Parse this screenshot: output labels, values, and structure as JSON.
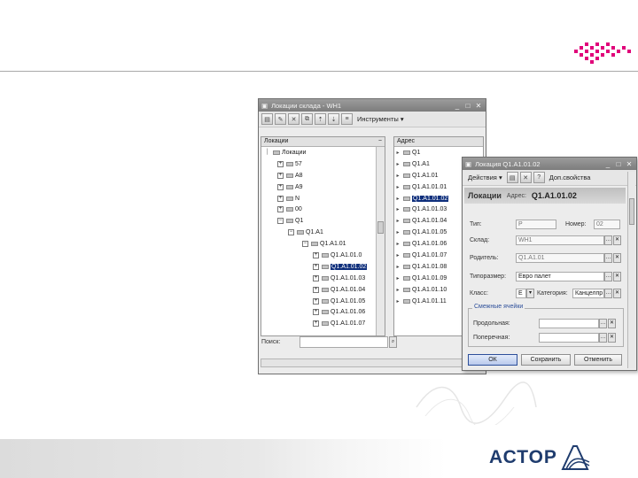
{
  "brand": {
    "logo_text": "АСТОР"
  },
  "main_window": {
    "title": "Локации склада - WH1",
    "toolbar": {
      "tools_menu": "Инструменты ▾"
    },
    "tree_header": "Локации",
    "tree_items": [
      {
        "label": "Локации"
      },
      {
        "label": "57"
      },
      {
        "label": "A8"
      },
      {
        "label": "A9"
      },
      {
        "label": "N"
      },
      {
        "label": "00"
      },
      {
        "label": "Q1"
      },
      {
        "label": "Q1.A1"
      },
      {
        "label": "Q1.A1.01"
      },
      {
        "label": "Q1.A1.01.0"
      },
      {
        "label": "Q1.A1.01.02"
      },
      {
        "label": "Q1.A1.01.03"
      },
      {
        "label": "Q1.A1.01.04"
      },
      {
        "label": "Q1.A1.01.05"
      },
      {
        "label": "Q1.A1.01.06"
      },
      {
        "label": "Q1.A1.01.07"
      }
    ],
    "address_header": "Адрес",
    "address_items": [
      {
        "label": "Q1"
      },
      {
        "label": "Q1.A1"
      },
      {
        "label": "Q1.A1.01"
      },
      {
        "label": "Q1.A1.01.01"
      },
      {
        "label": "Q1.A1.01.02"
      },
      {
        "label": "Q1.A1.01.03"
      },
      {
        "label": "Q1.A1.01.04"
      },
      {
        "label": "Q1.A1.01.05"
      },
      {
        "label": "Q1.A1.01.06"
      },
      {
        "label": "Q1.A1.01.07"
      },
      {
        "label": "Q1.A1.01.08"
      },
      {
        "label": "Q1.A1.01.09"
      },
      {
        "label": "Q1.A1.01.10"
      },
      {
        "label": "Q1.A1.01.11"
      }
    ],
    "search_label": "Поиск:",
    "search_value": ""
  },
  "dialog": {
    "title": "Локация Q1.A1.01.02",
    "toolbar": {
      "actions_menu": "Действия ▾",
      "extra_props": "Доп.свойства"
    },
    "header_label": "Локации",
    "address_label": "Адрес:",
    "address_value": "Q1.A1.01.02",
    "type_label": "Тип:",
    "type_value": "P",
    "number_label": "Номер:",
    "number_value": "02",
    "warehouse_label": "Склад:",
    "warehouse_value": "WH1",
    "parent_label": "Родитель:",
    "parent_value": "Q1.A1.01",
    "size_label": "Типоразмер:",
    "size_value": "Евро палет",
    "class_label": "Класс:",
    "class_value": "E",
    "category_label": "Категория:",
    "category_value": "Канцелпр",
    "group_label": "Смежные ячейки",
    "long_label": "Продольная:",
    "long_value": "",
    "cross_label": "Поперечная:",
    "cross_value": "",
    "ok_label": "ОК",
    "save_label": "Сохранить",
    "cancel_label": "Отменить"
  }
}
